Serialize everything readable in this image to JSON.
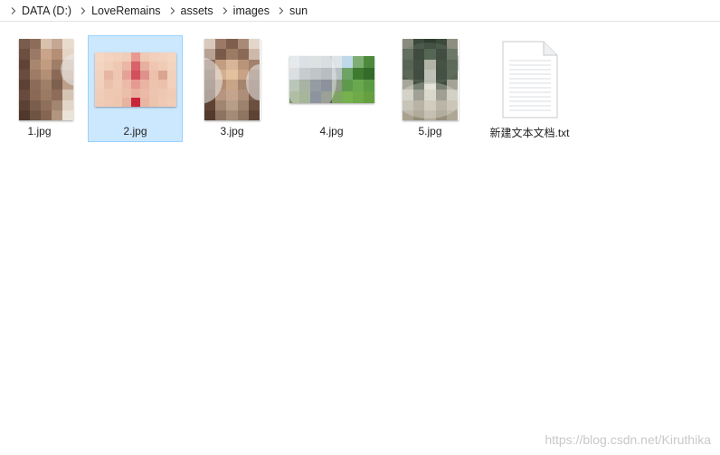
{
  "breadcrumb": {
    "items": [
      "DATA (D:)",
      "LoveRemains",
      "assets",
      "images",
      "sun"
    ]
  },
  "files": [
    {
      "name": "1.jpg",
      "type": "image",
      "selected": false
    },
    {
      "name": "2.jpg",
      "type": "image",
      "selected": true
    },
    {
      "name": "3.jpg",
      "type": "image",
      "selected": false
    },
    {
      "name": "4.jpg",
      "type": "image",
      "selected": false
    },
    {
      "name": "5.jpg",
      "type": "image",
      "selected": false
    },
    {
      "name": "新建文本文档.txt",
      "type": "text",
      "selected": false
    }
  ],
  "watermark": "https://blog.csdn.net/Kiruthika",
  "colors": {
    "selection_fill": "#cce8ff",
    "selection_border": "#99d1ff"
  }
}
